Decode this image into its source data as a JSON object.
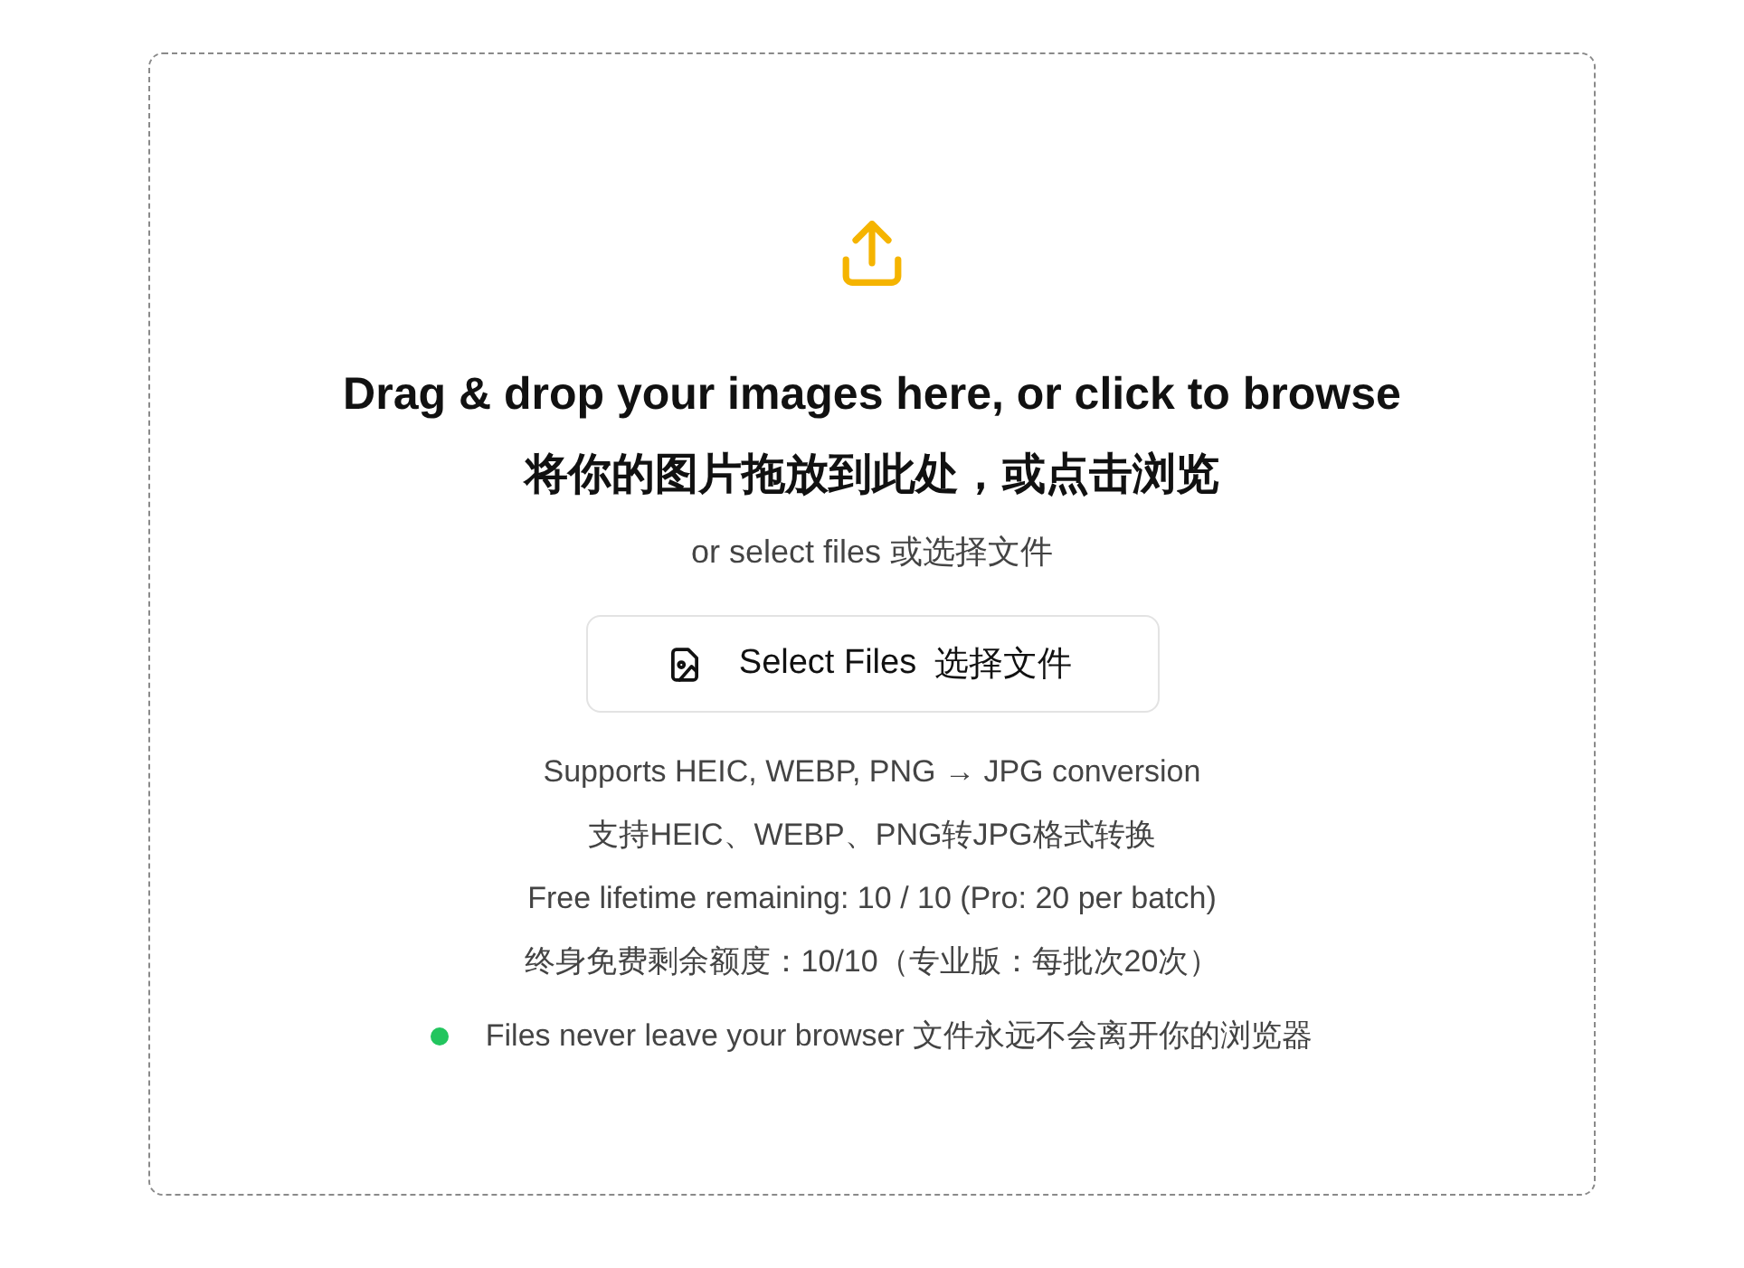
{
  "dropzone": {
    "title": "Drag & drop your images here, or click to browse",
    "title_zh": "将你的图片拖放到此处，或点击浏览",
    "subtitle": "or select files 或选择文件",
    "button": {
      "label": "Select Files",
      "label_zh": "选择文件"
    },
    "info_lines": [
      "Supports HEIC, WEBP, PNG → JPG conversion",
      "支持HEIC、WEBP、PNG转JPG格式转换",
      "Free lifetime remaining: 10 / 10 (Pro: 20 per batch)",
      "终身免费剩余额度：10/10（专业版：每批次20次）"
    ],
    "privacy_note": "Files never leave your browser 文件永远不会离开你的浏览器"
  }
}
